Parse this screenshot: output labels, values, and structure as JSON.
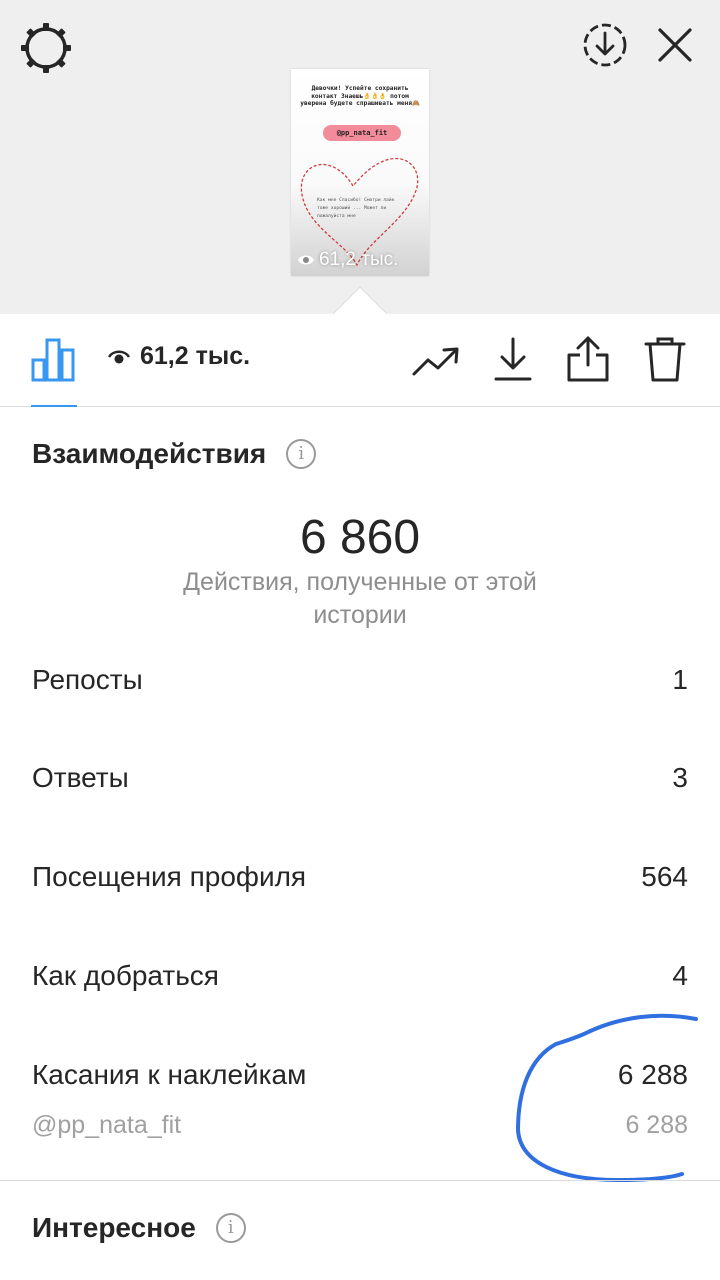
{
  "preview": {
    "thumb_text": "Девочки! Успейте сохранить контакт Знаешь👌👌👌 потом уверена будете спрашивать меня🙈",
    "thumb_pill": "@pp_nata_fit",
    "thumb_lines": "Как мне Спасибо! Смотри лайк тоже хороший ... Может ли пожалуйста мне",
    "thumb_views": "61,2 тыс."
  },
  "toolbar": {
    "views": "61,2 тыс."
  },
  "interactions": {
    "title": "Взаимодействия",
    "info": "i",
    "total": "6 860",
    "caption": "Действия, полученные от этой истории",
    "rows": [
      {
        "label": "Репосты",
        "value": "1"
      },
      {
        "label": "Ответы",
        "value": "3"
      },
      {
        "label": "Посещения профиля",
        "value": "564"
      },
      {
        "label": "Как добраться",
        "value": "4"
      },
      {
        "label": "Касания к наклейкам",
        "value": "6 288"
      }
    ],
    "sticker": {
      "label": "@pp_nata_fit",
      "value": "6 288"
    }
  },
  "discovery": {
    "title": "Интересное",
    "info": "i"
  },
  "colors": {
    "accent": "#3897f0",
    "scribble": "#2f6fe0",
    "secondary_text": "#8e8e8e"
  }
}
